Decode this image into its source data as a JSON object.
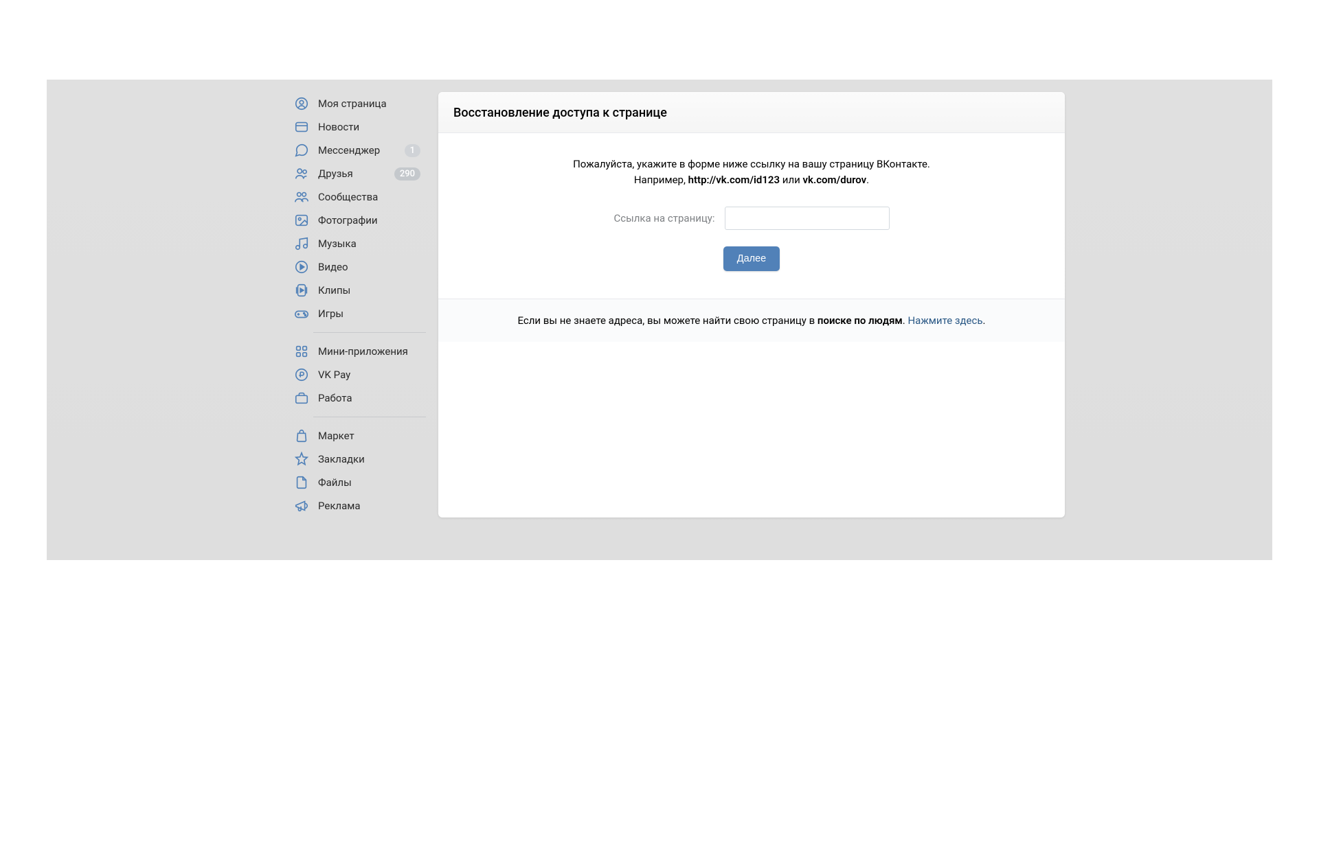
{
  "sidebar": {
    "items": [
      {
        "label": "Моя страница",
        "icon": "profile"
      },
      {
        "label": "Новости",
        "icon": "news"
      },
      {
        "label": "Мессенджер",
        "icon": "messages",
        "badge": "1"
      },
      {
        "label": "Друзья",
        "icon": "friends",
        "badge": "290"
      },
      {
        "label": "Сообщества",
        "icon": "groups"
      },
      {
        "label": "Фотографии",
        "icon": "photos"
      },
      {
        "label": "Музыка",
        "icon": "music"
      },
      {
        "label": "Видео",
        "icon": "video"
      },
      {
        "label": "Клипы",
        "icon": "clips"
      },
      {
        "label": "Игры",
        "icon": "games"
      }
    ],
    "section2": [
      {
        "label": "Мини-приложения",
        "icon": "miniapps"
      },
      {
        "label": "VK Pay",
        "icon": "pay"
      },
      {
        "label": "Работа",
        "icon": "work"
      }
    ],
    "section3": [
      {
        "label": "Маркет",
        "icon": "market"
      },
      {
        "label": "Закладки",
        "icon": "bookmarks"
      },
      {
        "label": "Файлы",
        "icon": "files"
      },
      {
        "label": "Реклама",
        "icon": "ads"
      }
    ]
  },
  "main": {
    "title": "Восстановление доступа к странице",
    "instruction_line1": "Пожалуйста, укажите в форме ниже ссылку на вашу страницу ВКонтакте.",
    "instruction_prefix": "Например, ",
    "instruction_example1": "http://vk.com/id123",
    "instruction_or": " или ",
    "instruction_example2": "vk.com/durov",
    "instruction_suffix": ".",
    "form_label": "Ссылка на страницу:",
    "submit_label": "Далее",
    "footer_prefix": "Если вы не знаете адреса, вы можете найти свою страницу в ",
    "footer_bold": "поиске по людям",
    "footer_dot": ". ",
    "footer_link": "Нажмите здесь",
    "footer_suffix": "."
  }
}
